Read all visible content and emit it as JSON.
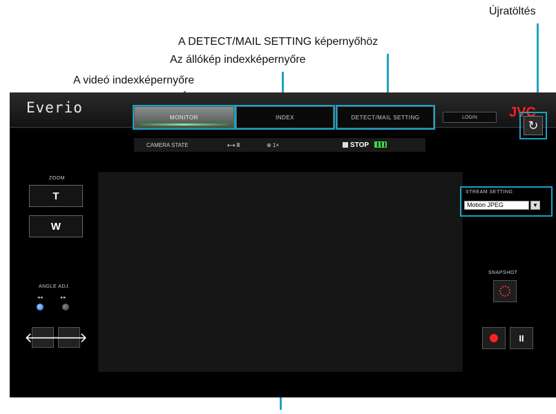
{
  "callouts": {
    "reload": "Újratöltés",
    "detect_mail": "A DETECT/MAIL SETTING képernyőhöz",
    "still_index": "Az állókép indexképernyőre",
    "video_index": "A videó indexképernyőre"
  },
  "app": {
    "logo": "Everio",
    "brand": "JVC",
    "tabs": [
      "MONITOR",
      "INDEX",
      "DETECT/MAIL SETTING"
    ],
    "small_button": "LOGIN"
  },
  "statusbar": {
    "camera_state": "CAMERA STATE",
    "pan": "⟷ II",
    "zoom": "⊕ 1×",
    "stop": "STOP",
    "battery_icon": "battery-icon"
  },
  "left_panel": {
    "zoom_label": "ZOOM",
    "zoom_in": "T",
    "zoom_out": "W",
    "angle_label": "ANGLE ADJ.",
    "angle_sub": [
      "◂◂",
      "▸▸"
    ]
  },
  "right_panel": {
    "stream_label": "STREAM SETTING",
    "stream_value": "Motion JPEG",
    "snapshot_label": "SNAPSHOT",
    "colors": {
      "accent": "#1aa3c8",
      "record": "#ff2020",
      "brand": "#ff1f1f"
    }
  }
}
